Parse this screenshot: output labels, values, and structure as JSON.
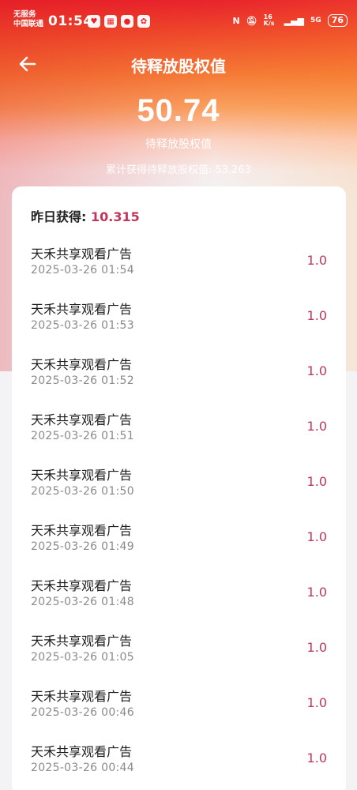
{
  "status_bar": {
    "carrier_line1": "无服务",
    "carrier_line2": "中国联通",
    "time": "01:54",
    "net_speed": "16 K/s",
    "signal_5g": "5G",
    "battery": "76"
  },
  "header": {
    "title": "待释放股权值"
  },
  "summary": {
    "value": "50.74",
    "value_label": "待释放股权值",
    "total_line": "累计获得待释放股权值: 53.263"
  },
  "card": {
    "yesterday_label": "昨日获得:",
    "yesterday_value": "10.315",
    "records": [
      {
        "name": "天禾共享观看广告",
        "time": "2025-03-26 01:54",
        "amount": "1.0"
      },
      {
        "name": "天禾共享观看广告",
        "time": "2025-03-26 01:53",
        "amount": "1.0"
      },
      {
        "name": "天禾共享观看广告",
        "time": "2025-03-26 01:52",
        "amount": "1.0"
      },
      {
        "name": "天禾共享观看广告",
        "time": "2025-03-26 01:51",
        "amount": "1.0"
      },
      {
        "name": "天禾共享观看广告",
        "time": "2025-03-26 01:50",
        "amount": "1.0"
      },
      {
        "name": "天禾共享观看广告",
        "time": "2025-03-26 01:49",
        "amount": "1.0"
      },
      {
        "name": "天禾共享观看广告",
        "time": "2025-03-26 01:48",
        "amount": "1.0"
      },
      {
        "name": "天禾共享观看广告",
        "time": "2025-03-26 01:05",
        "amount": "1.0"
      },
      {
        "name": "天禾共享观看广告",
        "time": "2025-03-26 00:46",
        "amount": "1.0"
      },
      {
        "name": "天禾共享观看广告",
        "time": "2025-03-26 00:44",
        "amount": "1.0"
      }
    ]
  },
  "colors": {
    "accent": "#c2365c",
    "header_red": "#e8232c",
    "header_orange": "#f57a35"
  }
}
